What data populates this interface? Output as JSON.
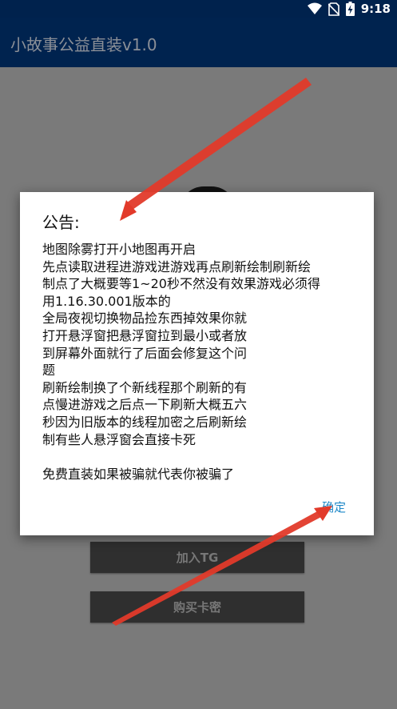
{
  "status": {
    "time": "9:18"
  },
  "app": {
    "title": "小故事公益直装v1.0"
  },
  "buttons": {
    "join_tg": "加入TG",
    "buy_key": "购买卡密"
  },
  "dialog": {
    "title": "公告:",
    "lines": [
      "地图除雾打开小地图再开启",
      "先点读取进程进游戏进游戏再点刷新绘制刷新绘",
      "制点了大概要等1~20秒不然没有效果游戏必须得",
      "用1.16.30.001版本的",
      "全局夜视切换物品捡东西掉效果你就",
      "打开悬浮窗把悬浮窗拉到最小或者放",
      "到屏幕外面就行了后面会修复这个问",
      "题",
      "刷新绘制换了个新线程那个刷新的有",
      "点慢进游戏之后点一下刷新大概五六",
      "秒因为旧版本的线程加密之后刷新绘",
      "制有些人悬浮窗会直接卡死",
      "",
      "免费直装如果被骗就代表你被骗了"
    ],
    "confirm": "确定"
  },
  "colors": {
    "appbar": "#00234f",
    "confirm": "#1e88c8",
    "arrow": "#e23a2a"
  },
  "icons": [
    "wifi-icon",
    "no-sim-icon",
    "battery-charging-icon"
  ]
}
